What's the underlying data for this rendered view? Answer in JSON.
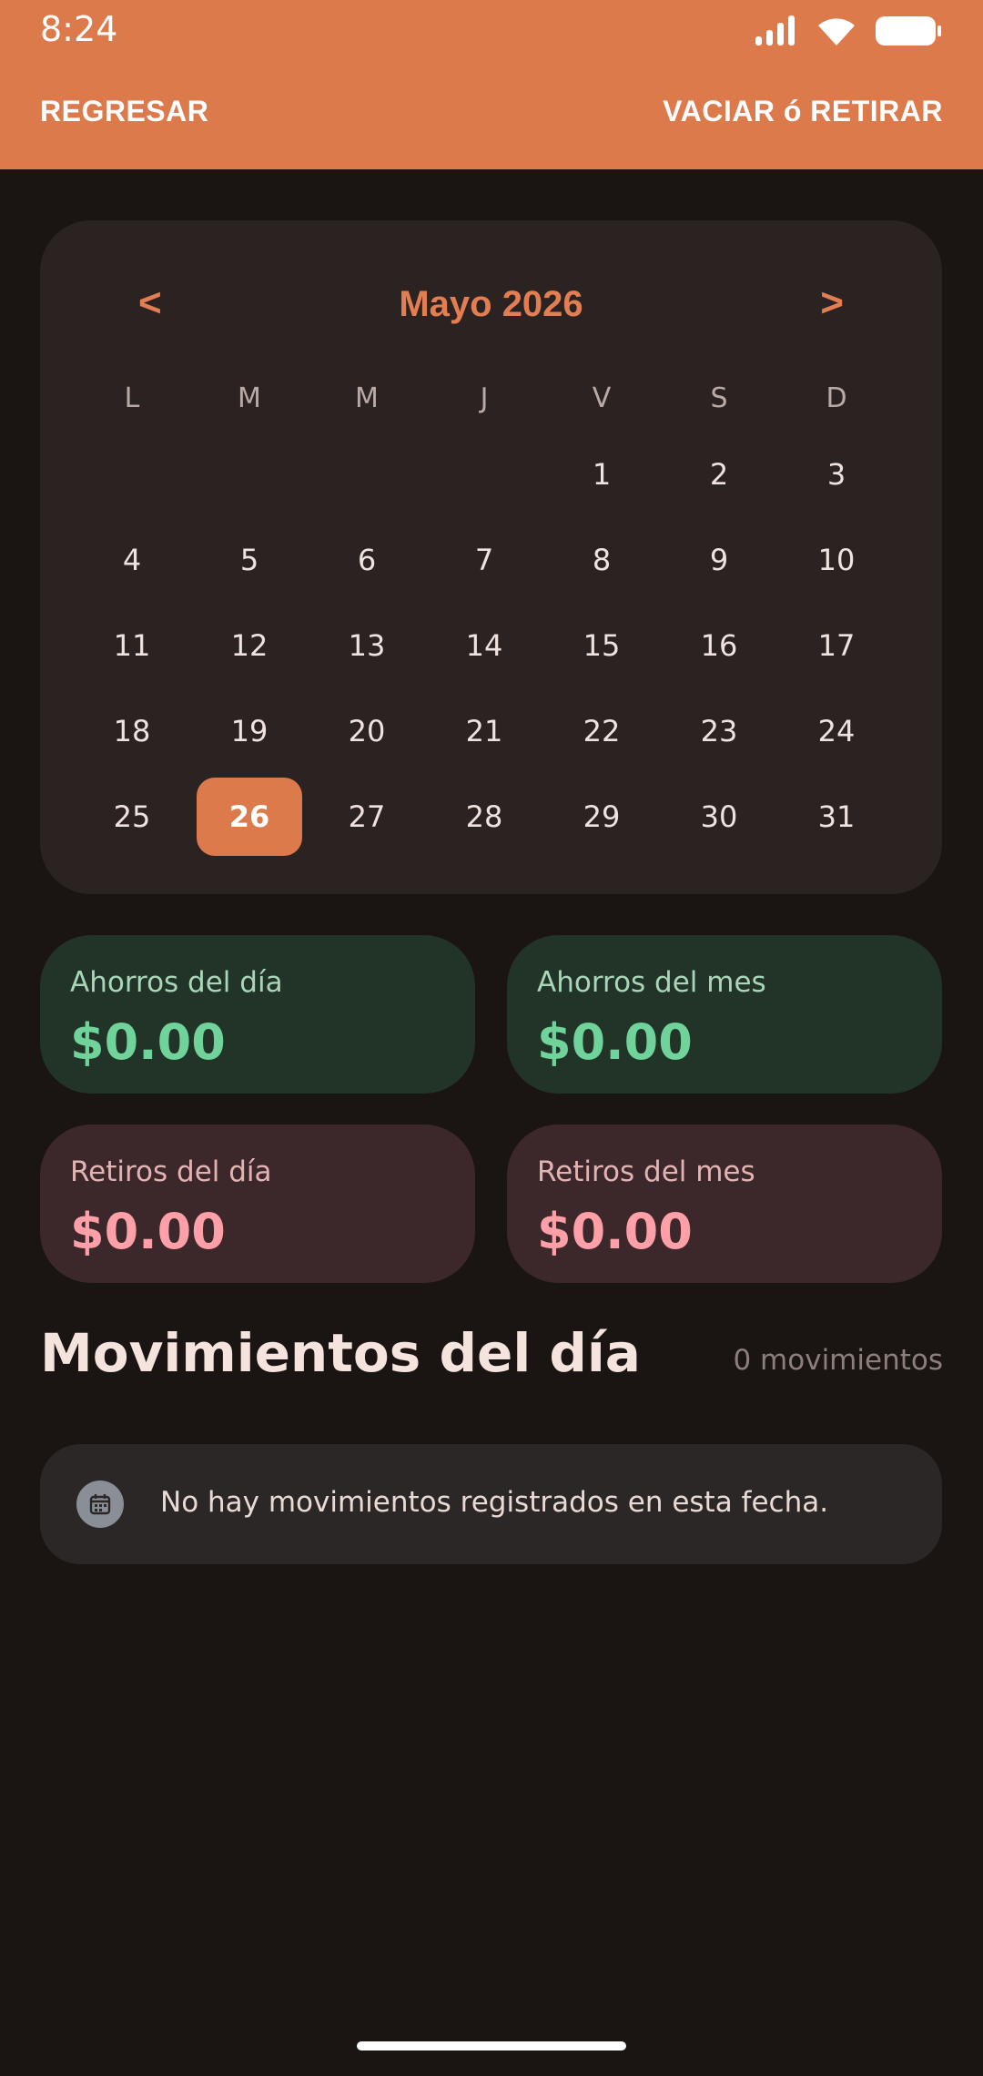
{
  "status_bar": {
    "time": "8:24",
    "icons": [
      "signal-icon",
      "wifi-icon",
      "battery-icon"
    ]
  },
  "top_bar": {
    "back_label": "REGRESAR",
    "action_label": "VACIAR ó RETIRAR",
    "color": "#dd7a4c"
  },
  "calendar": {
    "month_title": "Mayo 2026",
    "prev": "<",
    "next": ">",
    "weekdays": [
      "L",
      "M",
      "M",
      "J",
      "V",
      "S",
      "D"
    ],
    "first_weekday_index": 4,
    "days": [
      "1",
      "2",
      "3",
      "4",
      "5",
      "6",
      "7",
      "8",
      "9",
      "10",
      "11",
      "12",
      "13",
      "14",
      "15",
      "16",
      "17",
      "18",
      "19",
      "20",
      "21",
      "22",
      "23",
      "24",
      "25",
      "26",
      "27",
      "28",
      "29",
      "30",
      "31"
    ],
    "selected_day": "26"
  },
  "stats": {
    "savings_day": {
      "label": "Ahorros del día",
      "value": "$0.00"
    },
    "savings_month": {
      "label": "Ahorros del mes",
      "value": "$0.00"
    },
    "withdrawals_day": {
      "label": "Retiros del día",
      "value": "$0.00"
    },
    "withdrawals_month": {
      "label": "Retiros del mes",
      "value": "$0.00"
    }
  },
  "movements": {
    "title": "Movimientos del día",
    "count": "0 movimientos",
    "empty_message": "No hay movimientos registrados en esta fecha.",
    "empty_icon": "calendar-icon"
  },
  "colors": {
    "accent": "#dd7a4c",
    "background": "#1a1412",
    "savings_value": "#6fd39a",
    "withdrawals_value": "#ffa0a8"
  }
}
